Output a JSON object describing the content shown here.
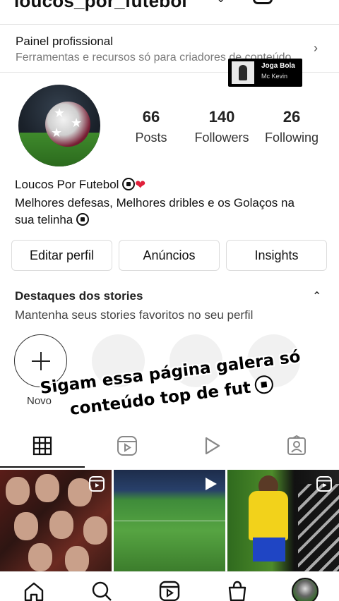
{
  "header": {
    "username": "loucos_por_futebol"
  },
  "pro_panel": {
    "title": "Painel profissional",
    "subtitle": "Ferramentas e recursos só para criadores de conteúdo."
  },
  "music": {
    "title": "Joga Bola",
    "artist": "Mc Kevin"
  },
  "stats": [
    {
      "value": "66",
      "label": "Posts"
    },
    {
      "value": "140",
      "label": "Followers"
    },
    {
      "value": "26",
      "label": "Following"
    }
  ],
  "bio": {
    "name": "Loucos Por Futebol",
    "line1": "Melhores defesas, Melhores dribles e os Golaços na",
    "line2": "sua telinha"
  },
  "buttons": {
    "edit": "Editar perfil",
    "ads": "Anúncios",
    "insights": "Insights"
  },
  "highlights": {
    "title": "Destaques dos stories",
    "subtitle": "Mantenha seus stories favoritos no seu perfil",
    "new_label": "Novo"
  },
  "overlay": {
    "line1": "Sigam essa página galera só",
    "line2": "conteúdo top de fut"
  },
  "colors": {
    "accent": "#111111",
    "heart": "#e0203a",
    "muted": "#7a7a7a"
  }
}
